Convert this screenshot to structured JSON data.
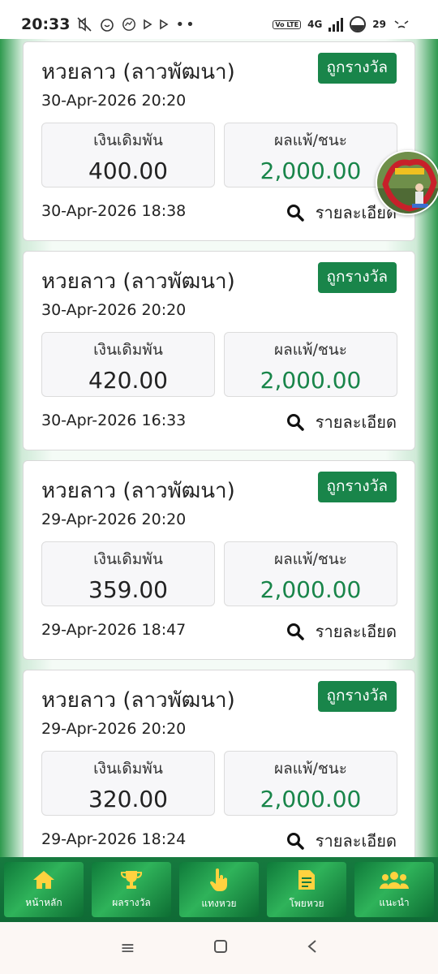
{
  "status_bar": {
    "time": "20:33",
    "network": "4G",
    "volte": "Vo LTE",
    "battery": "29",
    "icons": [
      "mute-icon",
      "alarm-icon",
      "messenger-icon",
      "play-icon",
      "play-icon",
      "more-dots-icon"
    ]
  },
  "cards": [
    {
      "title": "หวยลาว (ลาวพัฒนา)",
      "badge": "ถูกรางวัล",
      "draw_date": "30-Apr-2026 20:20",
      "stake_label": "เงินเดิมพัน",
      "stake_value": "400.00",
      "result_label": "ผลแพ้/ชนะ",
      "result_value": "2,000.00",
      "bet_time": "30-Apr-2026 18:38",
      "detail_label": "รายละเอียด"
    },
    {
      "title": "หวยลาว (ลาวพัฒนา)",
      "badge": "ถูกรางวัล",
      "draw_date": "30-Apr-2026 20:20",
      "stake_label": "เงินเดิมพัน",
      "stake_value": "420.00",
      "result_label": "ผลแพ้/ชนะ",
      "result_value": "2,000.00",
      "bet_time": "30-Apr-2026 16:33",
      "detail_label": "รายละเอียด"
    },
    {
      "title": "หวยลาว (ลาวพัฒนา)",
      "badge": "ถูกรางวัล",
      "draw_date": "29-Apr-2026 20:20",
      "stake_label": "เงินเดิมพัน",
      "stake_value": "359.00",
      "result_label": "ผลแพ้/ชนะ",
      "result_value": "2,000.00",
      "bet_time": "29-Apr-2026 18:47",
      "detail_label": "รายละเอียด"
    },
    {
      "title": "หวยลาว (ลาวพัฒนา)",
      "badge": "ถูกรางวัล",
      "draw_date": "29-Apr-2026 20:20",
      "stake_label": "เงินเดิมพัน",
      "stake_value": "320.00",
      "result_label": "ผลแพ้/ชนะ",
      "result_value": "2,000.00",
      "bet_time": "29-Apr-2026 18:24",
      "detail_label": "รายละเอียด"
    }
  ],
  "bottom_nav": [
    {
      "label": "หน้าหลัก",
      "icon": "home-icon"
    },
    {
      "label": "ผลรางวัล",
      "icon": "trophy-icon"
    },
    {
      "label": "แทงหวย",
      "icon": "pointer-hand-icon"
    },
    {
      "label": "โพยหวย",
      "icon": "document-icon"
    },
    {
      "label": "แนะนำ",
      "icon": "users-icon"
    }
  ],
  "colors": {
    "accent_green": "#19854a",
    "nav_green": "#167a3f",
    "badge_text": "#ffffff"
  }
}
